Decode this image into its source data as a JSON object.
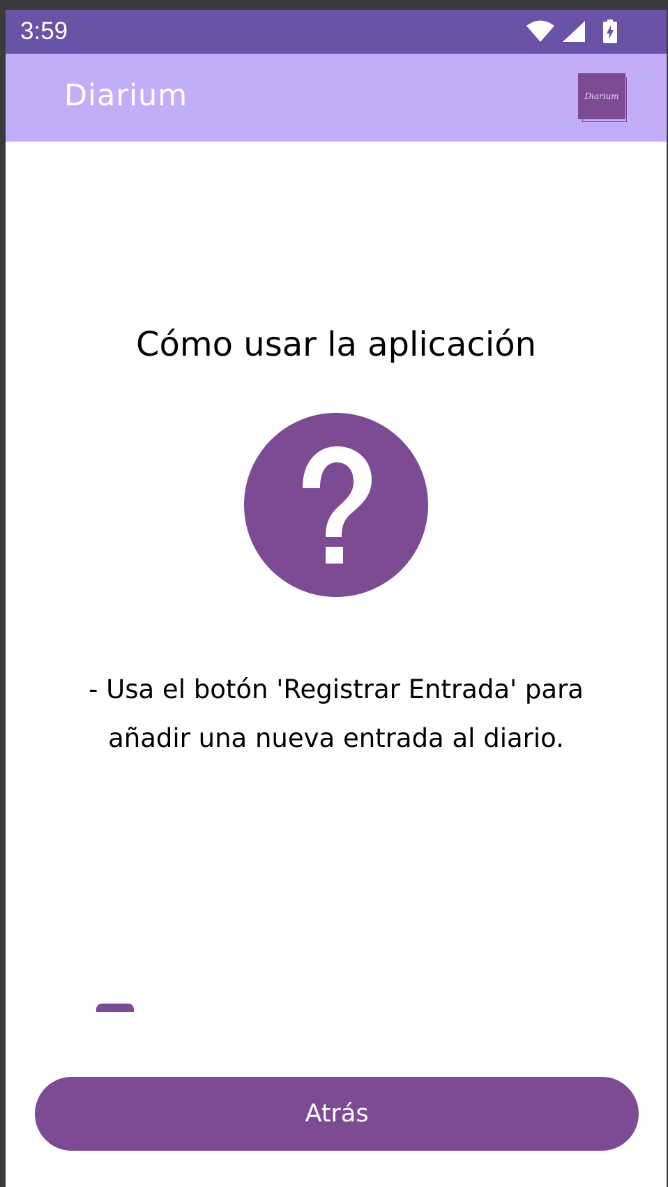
{
  "status_bar": {
    "time": "3:59",
    "icons": [
      "wifi-icon",
      "cell-signal-icon",
      "battery-charging-icon"
    ]
  },
  "app_bar": {
    "title": "Diarium",
    "logo_text": "Diarium"
  },
  "main": {
    "title": "Cómo usar la aplicación",
    "icon": "help-circle-icon",
    "tip": "- Usa el botón 'Registrar Entrada' para añadir una nueva entrada al diario."
  },
  "footer": {
    "back_label": "Atrás"
  },
  "colors": {
    "status_bar": "#6a53a6",
    "app_bar": "#c4adf8",
    "accent": "#7d4a94",
    "text": "#000000",
    "on_accent": "#ffffff"
  }
}
